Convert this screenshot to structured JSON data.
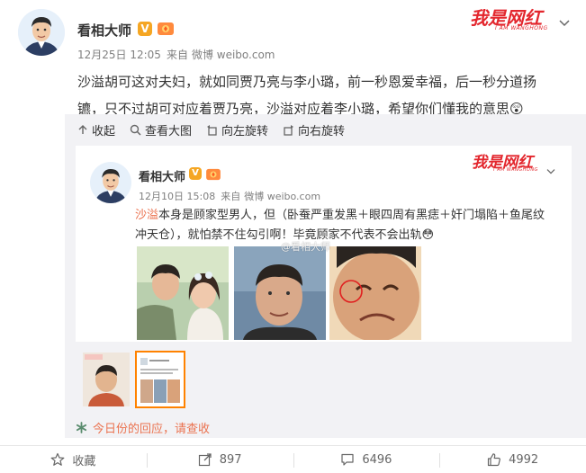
{
  "post": {
    "author": "看相大师",
    "verified_badge": "V",
    "time": "12月25日 12:05",
    "source_prefix": "来自",
    "source": "微博 weibo.com",
    "text_line1": "沙溢胡可这对夫妇，就如同贾乃亮与李小璐，前一秒恩爱幸福，后一秒分道扬",
    "text_line2": "镳，只不过胡可对应着贾乃亮，沙溢对应着李小璐，希望你们懂我的意思",
    "emoji": "😲"
  },
  "watermark": {
    "main": "我是网红",
    "sub": "I AM WANGHONG"
  },
  "toolbar": {
    "collapse": "收起",
    "view_large": "查看大图",
    "rotate_left": "向左旋转",
    "rotate_right": "向右旋转"
  },
  "inner_post": {
    "author": "看相大师",
    "verified_badge": "V",
    "time": "12月10日 15:08",
    "source_prefix": "来自",
    "source": "微博 weibo.com",
    "name_link": "沙溢",
    "text_line1": "本身是顾家型男人，但（卧蚕严重发黑＋眼四周有黑痣＋奸门塌陷＋鱼尾纹",
    "text_line2": "冲天仓），就怕禁不住勾引啊！毕竟顾家不代表不会出轨",
    "emoji": "😳",
    "image_watermark": "@看相大师"
  },
  "reply": {
    "text": "今日份的回应，请查收"
  },
  "footer": {
    "favorite": "收藏",
    "repost_count": "897",
    "comment_count": "6496",
    "like_count": "4992"
  },
  "colors": {
    "accent_orange": "#eb7350",
    "watermark_red": "#e3262d",
    "badge_gold": "#f5a623",
    "panel_gray": "#f2f2f5"
  },
  "icons": [
    "chevron-down-icon",
    "collapse-arrow-icon",
    "magnifier-icon",
    "rotate-left-icon",
    "rotate-right-icon",
    "reply-asterisk-icon",
    "star-icon",
    "repost-icon",
    "comment-icon",
    "like-icon"
  ]
}
